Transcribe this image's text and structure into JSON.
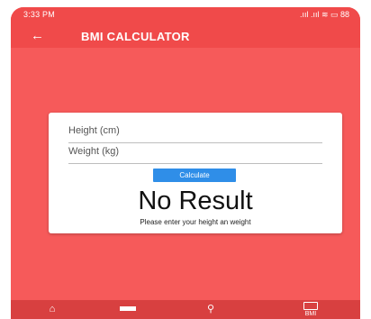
{
  "status_bar": {
    "time": "3:33 PM",
    "icons_text": ".ııl .ııl ≋ ▭ 88"
  },
  "app_bar": {
    "back_icon": "arrow-left-icon",
    "title": "BMI CALCULATOR"
  },
  "form": {
    "height_placeholder": "Height (cm)",
    "weight_placeholder": "Weight (kg)",
    "calculate_label": "Calculate"
  },
  "result": {
    "value": "No Result",
    "message": "Please enter your height an weight"
  },
  "bottom_nav": {
    "home_icon": "home-icon",
    "history_icon": "history-icon",
    "search_icon": "search-icon",
    "bmi_label": "BMI"
  },
  "colors": {
    "background": "#f65a5a",
    "app_bar": "#f04a4a",
    "button": "#2f8ee8",
    "nav": "#d84040"
  }
}
